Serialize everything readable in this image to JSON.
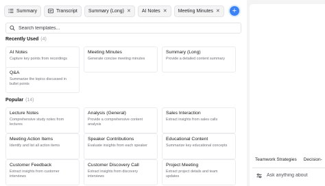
{
  "tabs": [
    {
      "label": "Summary",
      "closable": false,
      "icon": "list-icon"
    },
    {
      "label": "Transcript",
      "closable": false,
      "icon": "transcript-icon"
    },
    {
      "label": "Summary (Long)",
      "closable": true
    },
    {
      "label": "AI Notes",
      "closable": true
    },
    {
      "label": "Meeting Minutes",
      "closable": true
    }
  ],
  "add_button": "+",
  "search": {
    "placeholder": "Search templates..."
  },
  "recent": {
    "title": "Recently Used",
    "count": "(4)",
    "cards": [
      {
        "title": "AI Notes",
        "desc": "Capture key points from recordings"
      },
      {
        "title": "Meeting Minutes",
        "desc": "Generate concise meeting minutes"
      },
      {
        "title": "Summary (Long)",
        "desc": "Provide a detailed content summary"
      },
      {
        "title": "Q&A",
        "desc": "Summarize the topics discussed in bullet points"
      }
    ]
  },
  "popular": {
    "title": "Popular",
    "count": "(14)",
    "cards": [
      {
        "title": "Lecture Notes",
        "desc": "Comprehensive study notes from lectures"
      },
      {
        "title": "Analysis (General)",
        "desc": "Provide a comprehensive content analysis"
      },
      {
        "title": "Sales Interaction",
        "desc": "Extract insights from sales calls"
      },
      {
        "title": "Meeting Action Items",
        "desc": "Identify and list all action items"
      },
      {
        "title": "Speaker Contributions",
        "desc": "Evaluate insights from each speaker"
      },
      {
        "title": "Educational Content",
        "desc": "Summarize key educational concepts"
      },
      {
        "title": "Customer Feedback",
        "desc": "Extract insights from customer interviews"
      },
      {
        "title": "Customer Discovery Call",
        "desc": "Extract insights from discovery interviews"
      },
      {
        "title": "Project Meeting",
        "desc": "Extract project details and team updates"
      }
    ]
  },
  "assistant": {
    "suggestions": [
      "Teamwork Strategies",
      "Decision-"
    ],
    "ask_placeholder": "Ask anything about"
  },
  "colors": {
    "accent": "#3b82f6",
    "border": "#e4e4e7",
    "muted_text": "#71717a"
  }
}
